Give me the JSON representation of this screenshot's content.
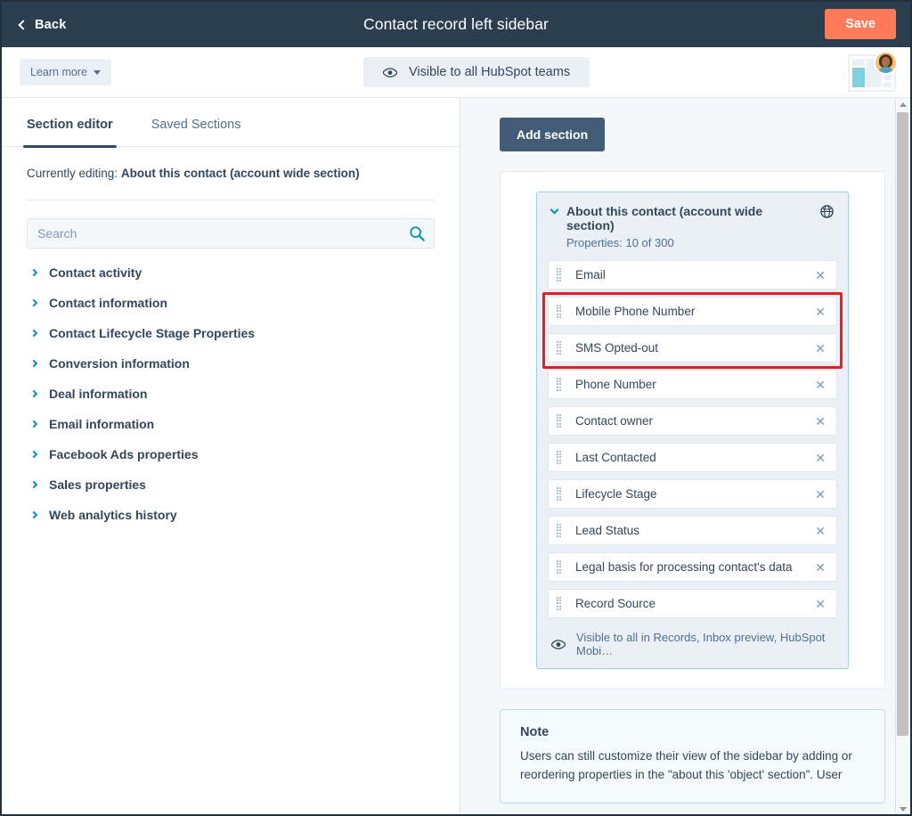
{
  "topbar": {
    "back_label": "Back",
    "title": "Contact record left sidebar",
    "save_label": "Save",
    "save_color": "#ff7a59",
    "bar_color": "#2b3e50"
  },
  "subbar": {
    "learn_more_label": "Learn more",
    "visibility_label": "Visible to all HubSpot teams"
  },
  "left_panel": {
    "tabs": [
      {
        "label": "Section editor",
        "active": true
      },
      {
        "label": "Saved Sections",
        "active": false
      }
    ],
    "currently_editing_prefix": "Currently editing:",
    "currently_editing_value": "About this contact (account wide section)",
    "search": {
      "placeholder": "Search",
      "value": ""
    },
    "groups": [
      {
        "label": "Contact activity"
      },
      {
        "label": "Contact information"
      },
      {
        "label": "Contact Lifecycle Stage Properties"
      },
      {
        "label": "Conversion information"
      },
      {
        "label": "Deal information"
      },
      {
        "label": "Email information"
      },
      {
        "label": "Facebook Ads properties"
      },
      {
        "label": "Sales properties"
      },
      {
        "label": "Web analytics history"
      }
    ]
  },
  "right_panel": {
    "add_section_label": "Add section",
    "section": {
      "title": "About this contact (account wide section)",
      "subtitle": "Properties: 10 of 300",
      "properties": [
        {
          "label": "Email",
          "highlighted": false
        },
        {
          "label": "Mobile Phone Number",
          "highlighted": true
        },
        {
          "label": "SMS Opted-out",
          "highlighted": true
        },
        {
          "label": "Phone Number",
          "highlighted": false
        },
        {
          "label": "Contact owner",
          "highlighted": false
        },
        {
          "label": "Last Contacted",
          "highlighted": false
        },
        {
          "label": "Lifecycle Stage",
          "highlighted": false
        },
        {
          "label": "Lead Status",
          "highlighted": false
        },
        {
          "label": "Legal basis for processing contact's data",
          "highlighted": false
        },
        {
          "label": "Record Source",
          "highlighted": false
        }
      ],
      "footer_label": "Visible to all in Records, Inbox preview, HubSpot Mobi…",
      "highlight_color": "#ec1c24"
    },
    "note": {
      "title": "Note",
      "body": "Users can still customize their view of the sidebar by adding or reordering properties in the \"about this 'object' section\". User"
    }
  }
}
